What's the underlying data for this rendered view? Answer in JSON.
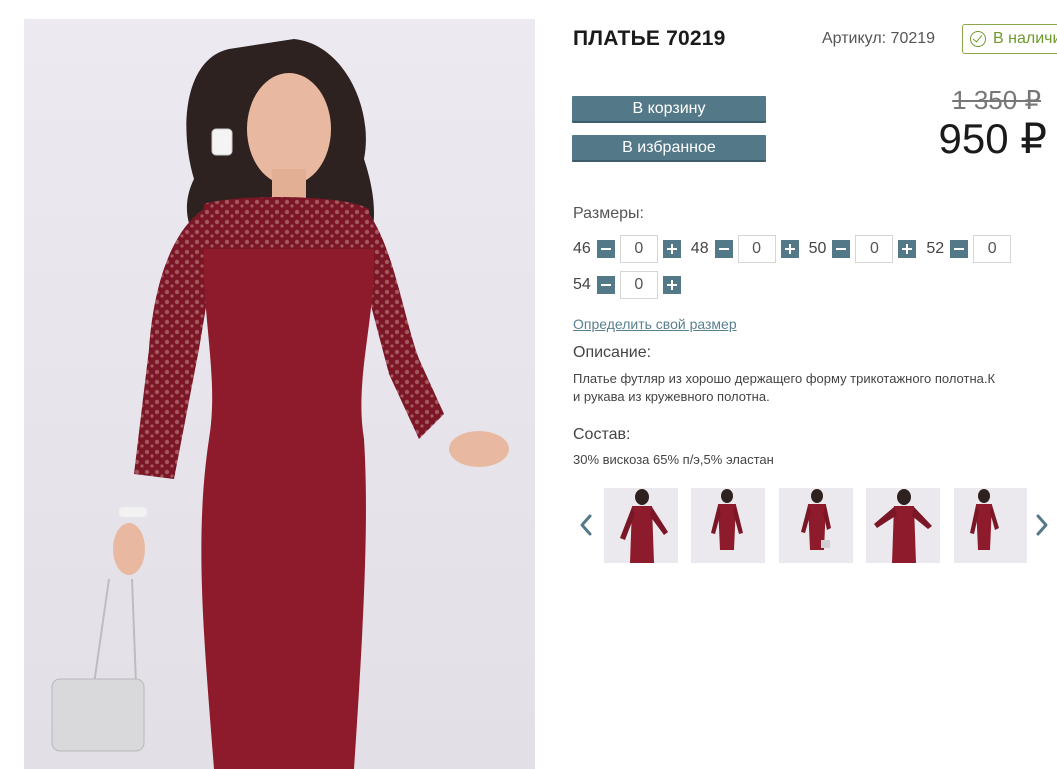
{
  "product": {
    "title": "ПЛАТЬЕ 70219",
    "article": "Артикул: 70219",
    "stock": "В наличии",
    "old_price": "1 350 ₽",
    "price": "950 ₽"
  },
  "buttons": {
    "cart": "В корзину",
    "favorite": "В избранное"
  },
  "sizes": {
    "label": "Размеры:",
    "items": [
      {
        "size": "46",
        "qty": "0"
      },
      {
        "size": "48",
        "qty": "0"
      },
      {
        "size": "50",
        "qty": "0"
      },
      {
        "size": "52",
        "qty": "0"
      },
      {
        "size": "54",
        "qty": "0"
      }
    ]
  },
  "size_link": "Определить свой размер",
  "description": {
    "label": "Описание:",
    "line1": "Платье футляр из хорошо держащего форму трикотажного полотна.К",
    "line2": "и рукава из кружевного полотна."
  },
  "composition": {
    "label": "Состав:",
    "text": "30% вискоза 65% п/э,5% эластан"
  },
  "gallery": {
    "thumbnails": [
      "thumb-1",
      "thumb-2",
      "thumb-3",
      "thumb-4",
      "thumb-5"
    ],
    "prev_icon": "chevron-left-icon",
    "next_icon": "chevron-right-icon"
  },
  "colors": {
    "accent": "#537989",
    "dress": "#8e1b2c",
    "stock": "#6f9a2c"
  }
}
